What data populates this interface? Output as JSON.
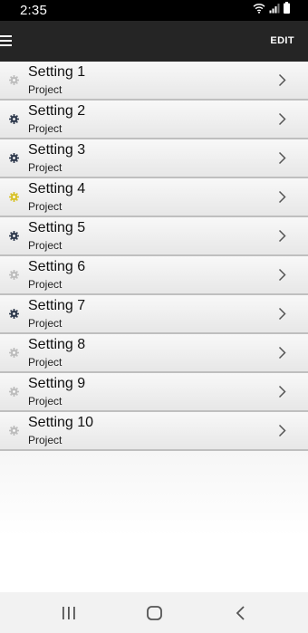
{
  "status_bar": {
    "time": "2:35",
    "icons": [
      "wifi-icon",
      "signal-icon",
      "battery-icon"
    ]
  },
  "app_bar": {
    "menu_icon": "menu-icon",
    "edit_label": "EDIT"
  },
  "colors": {
    "status_bar": "#000000",
    "app_bar": "#252525",
    "gear_light": "#bdbdbd",
    "gear_dark": "#2f3a4d",
    "gear_yellow": "#d8c22a"
  },
  "settings": [
    {
      "title": "Setting 1",
      "subtitle": "Project",
      "icon": "gear-light"
    },
    {
      "title": "Setting 2",
      "subtitle": "Project",
      "icon": "gear-dark"
    },
    {
      "title": "Setting 3",
      "subtitle": "Project",
      "icon": "gear-dark"
    },
    {
      "title": "Setting 4",
      "subtitle": "Project",
      "icon": "gear-yellow"
    },
    {
      "title": "Setting 5",
      "subtitle": "Project",
      "icon": "gear-dark"
    },
    {
      "title": "Setting 6",
      "subtitle": "Project",
      "icon": "gear-light"
    },
    {
      "title": "Setting 7",
      "subtitle": "Project",
      "icon": "gear-dark"
    },
    {
      "title": "Setting 8",
      "subtitle": "Project",
      "icon": "gear-light"
    },
    {
      "title": "Setting 9",
      "subtitle": "Project",
      "icon": "gear-light"
    },
    {
      "title": "Setting 10",
      "subtitle": "Project",
      "icon": "gear-light"
    }
  ],
  "nav_bar": {
    "buttons": [
      "recent-apps-icon",
      "home-icon",
      "back-icon"
    ]
  }
}
